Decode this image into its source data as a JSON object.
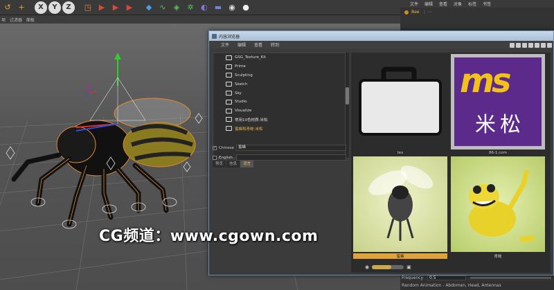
{
  "toolbar": {
    "buttons": [
      {
        "name": "undo",
        "glyph": "↺",
        "color": "#e5a532"
      },
      {
        "name": "add",
        "glyph": "+",
        "color": "#e5a532"
      },
      {
        "name": "x-axis",
        "glyph": "X",
        "color": "#5aa0e0"
      },
      {
        "name": "y-axis",
        "glyph": "Y",
        "color": "#5aa0e0"
      },
      {
        "name": "z-axis",
        "glyph": "Z",
        "color": "#5aa0e0"
      },
      {
        "name": "coord",
        "glyph": "◳",
        "color": "#e0843a"
      },
      {
        "name": "render-view",
        "glyph": "▶",
        "color": "#d84a3a"
      },
      {
        "name": "render-picture",
        "glyph": "▶",
        "color": "#d84a3a"
      },
      {
        "name": "render-settings",
        "glyph": "▶",
        "color": "#d84a3a"
      },
      {
        "name": "cube",
        "glyph": "◆",
        "color": "#4aa0e0"
      },
      {
        "name": "spline",
        "glyph": "∿",
        "color": "#5ac05a"
      },
      {
        "name": "nurbs",
        "glyph": "◈",
        "color": "#5ac05a"
      },
      {
        "name": "array",
        "glyph": "✲",
        "color": "#5ac05a"
      },
      {
        "name": "deformer",
        "glyph": "◐",
        "color": "#8a7ad8"
      },
      {
        "name": "scene",
        "glyph": "▬",
        "color": "#6a8ad8"
      },
      {
        "name": "camera",
        "glyph": "◉",
        "color": "#dddddd"
      },
      {
        "name": "light",
        "glyph": "●",
        "color": "#f0f0f0"
      }
    ]
  },
  "viewport_menu": [
    "项",
    "过滤器",
    "面板"
  ],
  "right_panel": {
    "menu": [
      "文件",
      "编辑",
      "查看",
      "对象",
      "标签",
      "书签"
    ],
    "object_name": "Bee"
  },
  "content_browser": {
    "title": "内容浏览器",
    "menu": [
      "文件",
      "编辑",
      "查看",
      "转到"
    ],
    "tree": [
      "GSG_Texture_Kit",
      "Prime",
      "Sculpting",
      "Sketch",
      "Sky",
      "Studio",
      "Visualize",
      "常用10色材质-米松",
      "蜜蜂和青蛙-米松"
    ],
    "selected_tree_index": 8,
    "info_tabs": [
      "预览",
      "信息",
      "语言"
    ],
    "active_info_tab": 2,
    "fields": [
      {
        "label": "Chinese",
        "value": "蜜蜂",
        "checked": true
      },
      {
        "label": "English",
        "value": "",
        "checked": false
      }
    ],
    "thumbnails": [
      {
        "caption": "tex",
        "kind": "folder"
      },
      {
        "caption": "86-1.com",
        "kind": "logo",
        "logo_text": "米松",
        "logo_letters": "ms"
      },
      {
        "caption": "蜜蜂",
        "kind": "bee",
        "selected": true
      },
      {
        "caption": "青蛙",
        "kind": "frog"
      }
    ]
  },
  "attributes": {
    "frequency_label": "Frequency",
    "frequency_value": "0.5",
    "random_animation": "Random Animation - Abdomen, Head, Antennas"
  },
  "watermark": "CG频道：www.cgown.com",
  "colors": {
    "accent": "#e5a532",
    "window_border": "#6b8fb4",
    "logo_bg": "#5b2a8a",
    "logo_yellow": "#f2c21b"
  }
}
